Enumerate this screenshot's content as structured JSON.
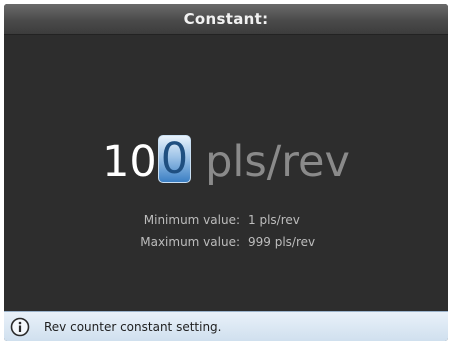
{
  "dialog": {
    "title": "Constant:"
  },
  "entry": {
    "digits_before_cursor": "10",
    "cursor_digit": "0",
    "unit": "pls/rev"
  },
  "limits": {
    "min_label": "Minimum value:",
    "min_value": "1 pls/rev",
    "max_label": "Maximum value:",
    "max_value": "999 pls/rev"
  },
  "status": {
    "icon": "info-icon",
    "message": "Rev counter constant setting."
  }
}
